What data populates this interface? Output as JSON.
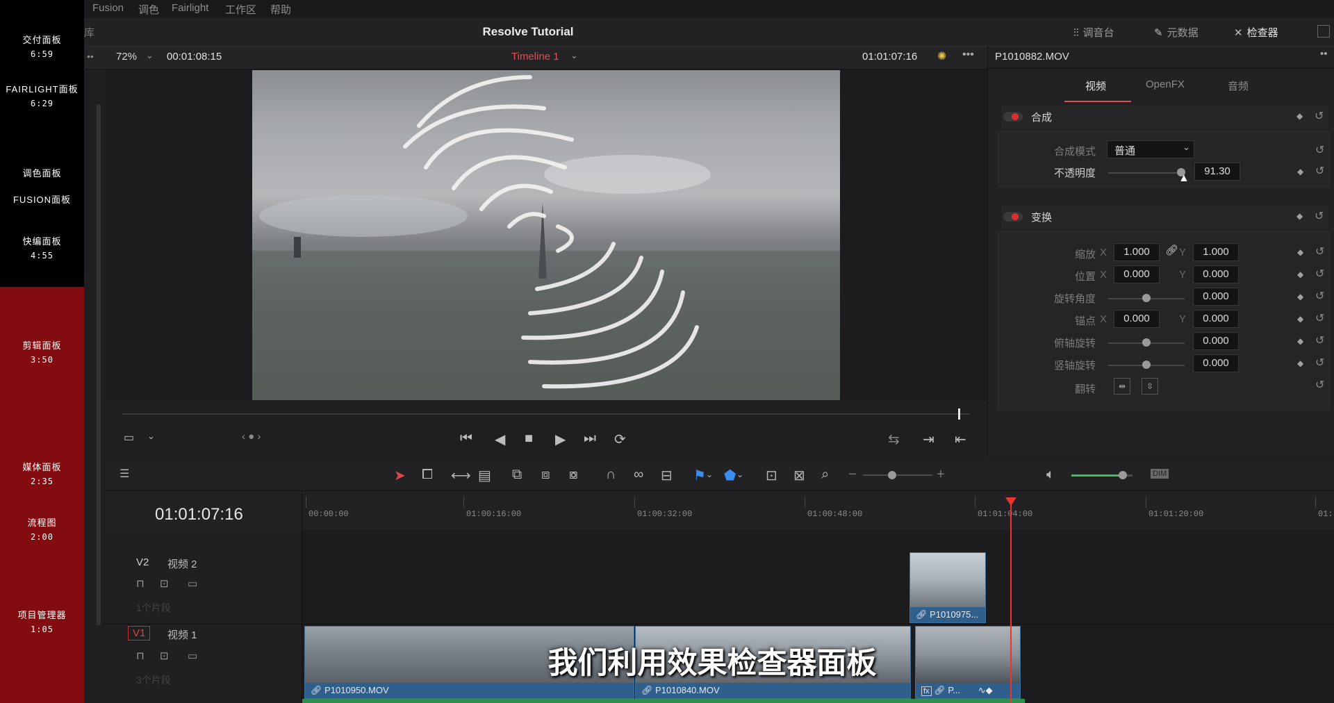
{
  "chapters": [
    {
      "label": "交付面板",
      "time": "6:59"
    },
    {
      "label": "FAIRLIGHT面板",
      "time": "6:29"
    },
    {
      "label": "调色面板",
      "time": ""
    },
    {
      "label": "FUSION面板",
      "time": ""
    },
    {
      "label": "快编面板",
      "time": "4:55"
    },
    {
      "label": "剪辑面板",
      "time": "3:50"
    },
    {
      "label": "媒体面板",
      "time": "2:35"
    },
    {
      "label": "流程图",
      "time": "2:00"
    },
    {
      "label": "项目管理器",
      "time": "1:05"
    }
  ],
  "menu": [
    "Fusion",
    "调色",
    "Fairlight",
    "工作区",
    "帮助"
  ],
  "titlebar": {
    "left_stub": "库",
    "project_title": "Resolve Tutorial",
    "mixer": "调音台",
    "metadata": "元数据",
    "inspector": "检查器"
  },
  "viewer": {
    "zoom": "72%",
    "timecode_left": "00:01:08:15",
    "timeline_name": "Timeline 1",
    "timecode_right": "01:01:07:16"
  },
  "inspector": {
    "clip_name": "P1010882.MOV",
    "tabs": [
      "视频",
      "OpenFX",
      "音频"
    ],
    "composite": {
      "title": "合成",
      "mode_label": "合成模式",
      "mode_value": "普通",
      "opacity_label": "不透明度",
      "opacity_value": "91.30"
    },
    "transform": {
      "title": "变换",
      "zoom_label": "缩放",
      "zoom_x": "1.000",
      "zoom_y": "1.000",
      "position_label": "位置",
      "position_x": "0.000",
      "position_y": "0.000",
      "rotation_label": "旋转角度",
      "rotation_value": "0.000",
      "anchor_label": "锚点",
      "anchor_x": "0.000",
      "anchor_y": "0.000",
      "pitch_label": "俯轴旋转",
      "pitch_value": "0.000",
      "yaw_label": "竖轴旋转",
      "yaw_value": "0.000",
      "flip_label": "翻转"
    }
  },
  "timeline": {
    "timecode": "01:01:07:16",
    "ruler_labels": [
      "00:00:00",
      "01:00:16:00",
      "01:00:32:00",
      "01:00:48:00",
      "01:01:04:00",
      "01:01:20:00",
      "01:"
    ],
    "tracks": [
      {
        "id": "V2",
        "name": "视频 2",
        "sub": "1个片段"
      },
      {
        "id": "V1",
        "name": "视频 1",
        "sub": "3个片段"
      }
    ],
    "clips": {
      "v2_clip": "P1010975...",
      "v1_clip1": "P1010950.MOV",
      "v1_clip2": "P1010840.MOV",
      "v1_clip3": "P..."
    }
  },
  "subtitle": "我们利用效果检查器面板",
  "colors": {
    "accent": "#e05050",
    "clip": "#2f5f8c",
    "chapter_red": "#820c0f"
  }
}
